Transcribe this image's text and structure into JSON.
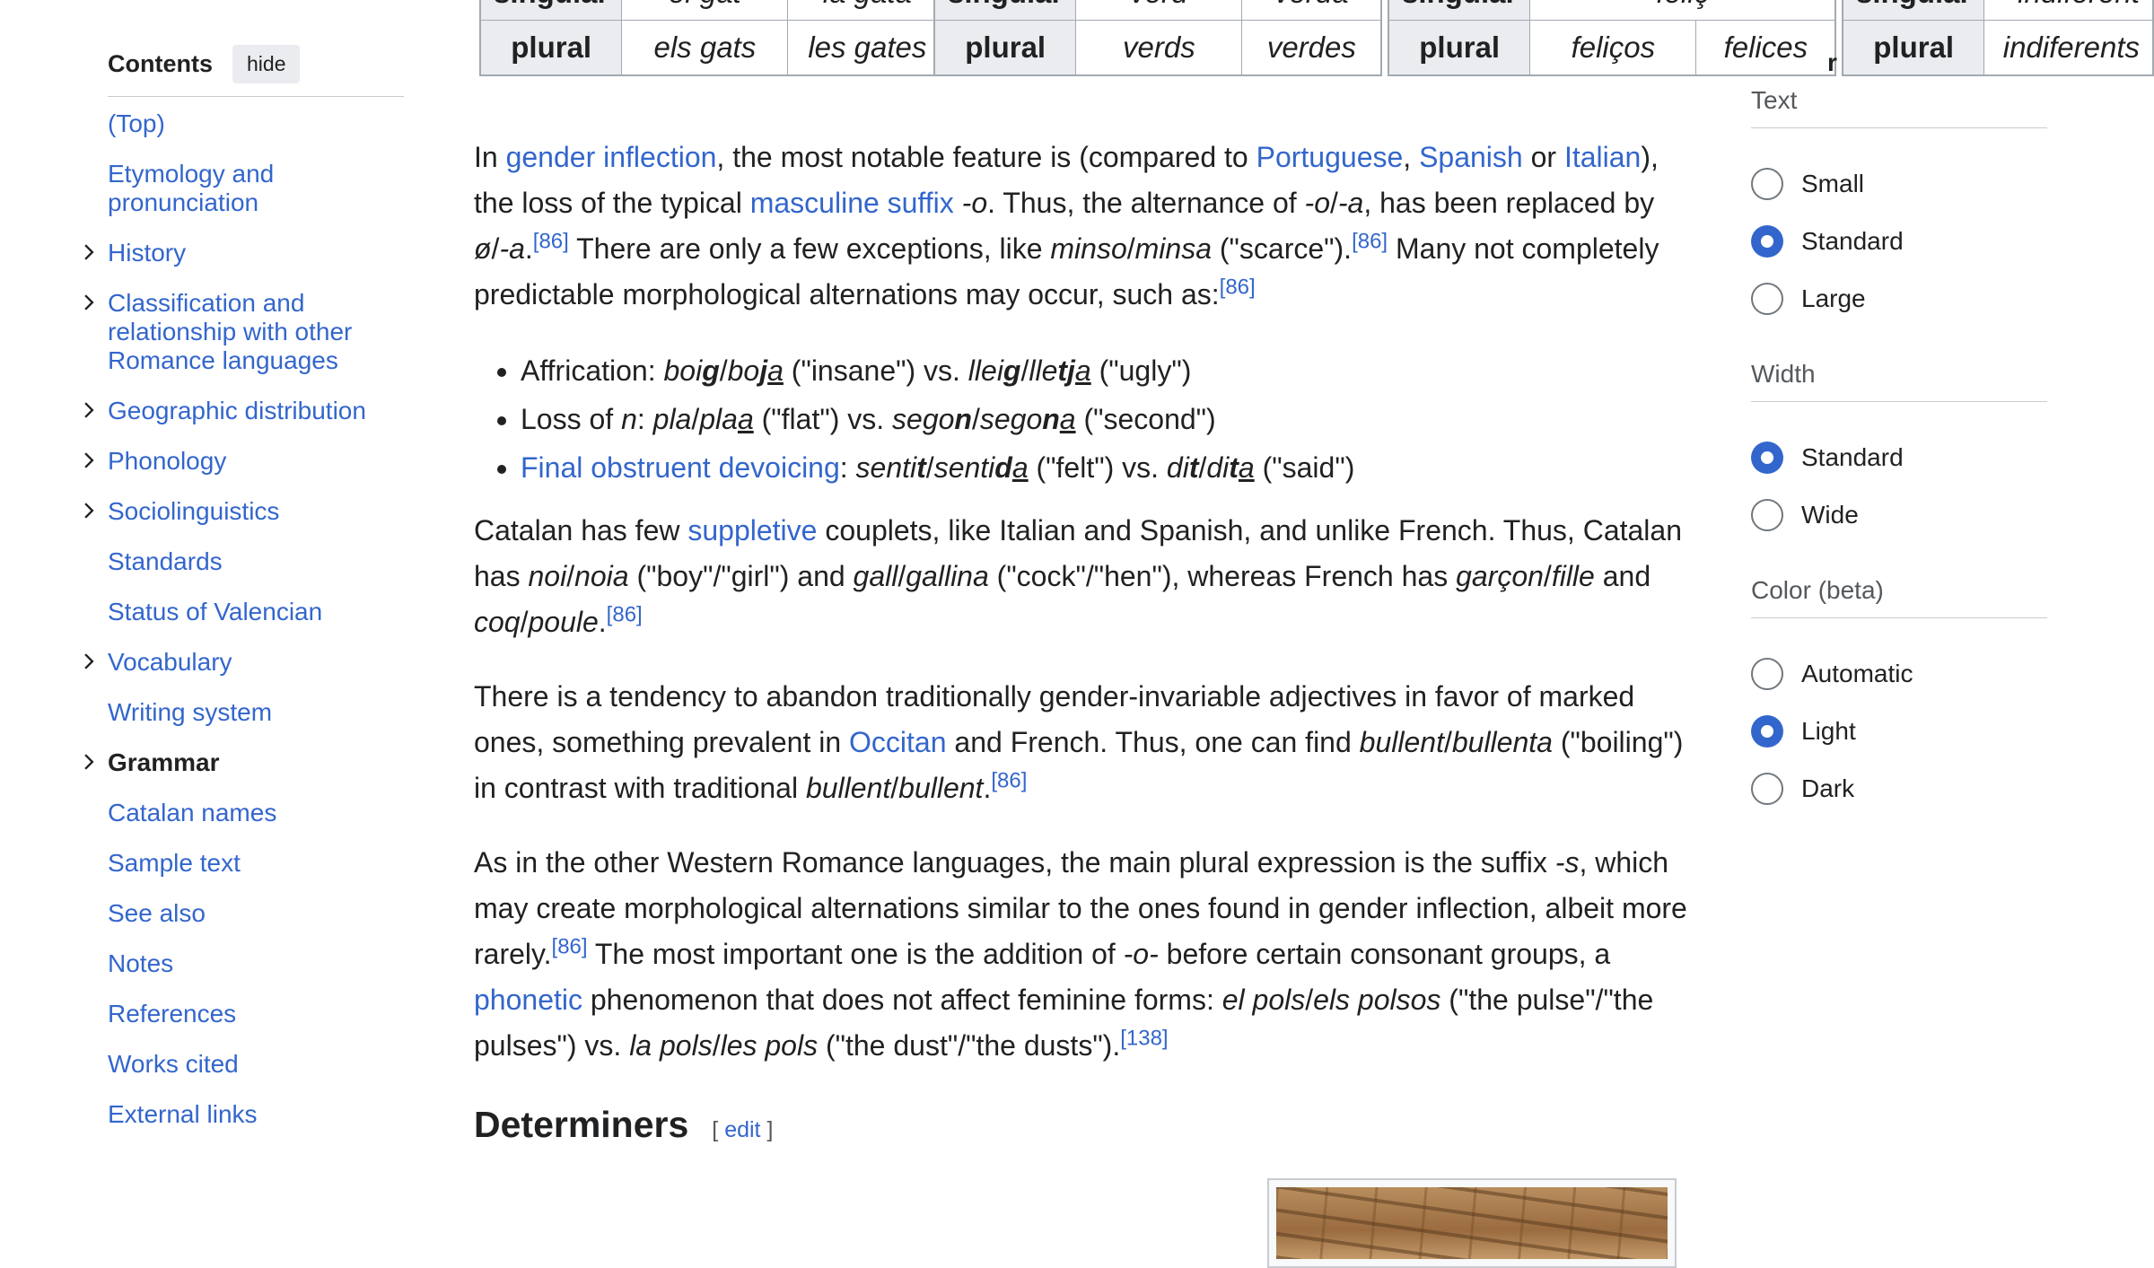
{
  "toc": {
    "title": "Contents",
    "hide_label": "hide",
    "items": [
      {
        "label": "(Top)",
        "expandable": false,
        "active": false
      },
      {
        "label": "Etymology and pronunciation",
        "expandable": false,
        "active": false
      },
      {
        "label": "History",
        "expandable": true,
        "active": false
      },
      {
        "label": "Classification and relationship with other Romance languages",
        "expandable": true,
        "active": false
      },
      {
        "label": "Geographic distribution",
        "expandable": true,
        "active": false
      },
      {
        "label": "Phonology",
        "expandable": true,
        "active": false
      },
      {
        "label": "Sociolinguistics",
        "expandable": true,
        "active": false
      },
      {
        "label": "Standards",
        "expandable": false,
        "active": false
      },
      {
        "label": "Status of Valencian",
        "expandable": false,
        "active": false
      },
      {
        "label": "Vocabulary",
        "expandable": true,
        "active": false
      },
      {
        "label": "Writing system",
        "expandable": false,
        "active": false
      },
      {
        "label": "Grammar",
        "expandable": true,
        "active": true
      },
      {
        "label": "Catalan names",
        "expandable": false,
        "active": false
      },
      {
        "label": "Sample text",
        "expandable": false,
        "active": false
      },
      {
        "label": "See also",
        "expandable": false,
        "active": false
      },
      {
        "label": "Notes",
        "expandable": false,
        "active": false
      },
      {
        "label": "References",
        "expandable": false,
        "active": false
      },
      {
        "label": "Works cited",
        "expandable": false,
        "active": false
      },
      {
        "label": "External links",
        "expandable": false,
        "active": false
      }
    ]
  },
  "tables": [
    {
      "rows": [
        {
          "head": "singular",
          "cells": [
            "el gat",
            "la gata"
          ]
        },
        {
          "head": "plural",
          "cells": [
            "els gats",
            "les gates"
          ]
        }
      ]
    },
    {
      "rows": [
        {
          "head": "singular",
          "cells": [
            "verd",
            "verda"
          ]
        },
        {
          "head": "plural",
          "cells": [
            "verds",
            "verdes"
          ]
        }
      ]
    },
    {
      "rows": [
        {
          "head": "singular",
          "cells": [
            "feliç",
            ""
          ]
        },
        {
          "head": "plural",
          "cells": [
            "feliços",
            "felices"
          ]
        }
      ]
    },
    {
      "rows": [
        {
          "head": "singular",
          "cells": [
            "indiferent"
          ]
        },
        {
          "head": "plural",
          "cells": [
            "indiferents"
          ]
        }
      ]
    }
  ],
  "stray_char": "r",
  "article": {
    "p1": {
      "t1": "In ",
      "l_gender": "gender inflection",
      "t2": ", the most notable feature is (compared to ",
      "l_portuguese": "Portuguese",
      "t3": ", ",
      "l_spanish": "Spanish",
      "t4": " or ",
      "l_italian": "Italian",
      "t5": "), the loss of the typical ",
      "l_suffix": "masculine suffix",
      "t6": " ",
      "i_o": "-o",
      "t7": ". Thus, the alternance of ",
      "i_oa": "-o",
      "t7b": "/",
      "i_a": "-a",
      "t8": ", has been replaced by ",
      "i_null": "ø",
      "t8b": "/",
      "i_a2": "-a",
      "t9": ".",
      "ref1": "[86]",
      "t10": " There are only a few exceptions, like ",
      "i_minso": "minso",
      "t10b": "/",
      "i_minsa": "minsa",
      "t11": " (\"scarce\").",
      "ref2": "[86]",
      "t12": " Many not completely predictable morphological alternations may occur, such as:",
      "ref3": "[86]"
    },
    "bullets": {
      "b1_label": "Affrication: ",
      "b1_w1a": "boi",
      "b1_w1b": "g",
      "b1_slash1": "/",
      "b1_w2a": "bo",
      "b1_w2b": "j",
      "b1_w2c": "a",
      "b1_gloss1": " (\"insane\") vs. ",
      "b1_w3a": "llei",
      "b1_w3b": "g",
      "b1_slash2": "/",
      "b1_w4a": "lle",
      "b1_w4b": "tj",
      "b1_w4c": "a",
      "b1_gloss2": " (\"ugly\")",
      "b2_label": "Loss of ",
      "b2_n": "n",
      "b2_colon": ": ",
      "b2_w1": "pla",
      "b2_slash1": "/",
      "b2_w2a": "pla",
      "b2_w2b": "n",
      "b2_w2c": "a",
      "b2_gloss1": " (\"flat\") vs. ",
      "b2_w3a": "sego",
      "b2_w3b": "n",
      "b2_slash2": "/",
      "b2_w4a": "sego",
      "b2_w4b": "n",
      "b2_w4c": "a",
      "b2_gloss2": " (\"second\")",
      "b3_link": "Final obstruent devoicing",
      "b3_colon": ": ",
      "b3_w1a": "senti",
      "b3_w1b": "t",
      "b3_slash1": "/",
      "b3_w2a": "senti",
      "b3_w2b": "d",
      "b3_w2c": "a",
      "b3_gloss1": " (\"felt\") vs. ",
      "b3_w3a": "di",
      "b3_w3b": "t",
      "b3_slash2": "/",
      "b3_w4a": "di",
      "b3_w4b": "t",
      "b3_w4c": "a",
      "b3_gloss2": " (\"said\")"
    },
    "p2": {
      "t1": "Catalan has few ",
      "l_suppletive": "suppletive",
      "t2": " couplets, like Italian and Spanish, and unlike French. Thus, Catalan has ",
      "i_noi": "noi",
      "t2b": "/",
      "i_noia": "noia",
      "t3": " (\"boy\"/\"girl\") and ",
      "i_gall": "gall",
      "t3b": "/",
      "i_gallina": "gallina",
      "t4": " (\"cock\"/\"hen\"), whereas French has ",
      "i_garcon": "garçon",
      "t4b": "/",
      "i_fille": "fille",
      "t5": " and ",
      "i_coq": "coq",
      "t5b": "/",
      "i_poule": "poule",
      "t6": ".",
      "ref": "[86]"
    },
    "p3": {
      "t1": "There is a tendency to abandon traditionally gender-invariable adjectives in favor of marked ones, something prevalent in ",
      "l_occitan": "Occitan",
      "t2": " and French. Thus, one can find ",
      "i_bullent1": "bullent",
      "t2b": "/",
      "i_bullenta": "bullenta",
      "t3": " (\"boiling\") in contrast with traditional ",
      "i_bullent2": "bullent",
      "t3b": "/",
      "i_bullent3": "bullent",
      "t4": ".",
      "ref": "[86]"
    },
    "p4": {
      "t1": "As in the other Western Romance languages, the main plural expression is the suffix ",
      "i_s": "-s",
      "t2": ", which may create morphological alternations similar to the ones found in gender inflection, albeit more rarely.",
      "ref1": "[86]",
      "t3": " The most important one is the addition of ",
      "i_o": "-o-",
      "t4": " before certain consonant groups, a ",
      "l_phonetic": "phonetic",
      "t5": " phenomenon that does not affect feminine forms: ",
      "i_elpols": "el pols",
      "t5b": "/",
      "i_elspolsos": "els polsos",
      "t6": " (\"the pulse\"/\"the pulses\") vs. ",
      "i_lapols": "la pols",
      "t6b": "/",
      "i_lespols": "les pols",
      "t7": " (\"the dust\"/\"the dusts\").",
      "ref2": "[138]"
    },
    "section_heading": "Determiners",
    "edit_open": "[ ",
    "edit_label": "edit",
    "edit_close": " ]"
  },
  "appearance": {
    "groups": [
      {
        "title": "Text",
        "options": [
          {
            "label": "Small",
            "selected": false
          },
          {
            "label": "Standard",
            "selected": true
          },
          {
            "label": "Large",
            "selected": false
          }
        ]
      },
      {
        "title": "Width",
        "options": [
          {
            "label": "Standard",
            "selected": true
          },
          {
            "label": "Wide",
            "selected": false
          }
        ]
      },
      {
        "title": "Color (beta)",
        "options": [
          {
            "label": "Automatic",
            "selected": false
          },
          {
            "label": "Light",
            "selected": true
          },
          {
            "label": "Dark",
            "selected": false
          }
        ]
      }
    ]
  },
  "colors": {
    "link": "#3366cc",
    "radio_selected": "#3366cc",
    "table_header": "#eaecf0",
    "border": "#a2a9b1"
  }
}
